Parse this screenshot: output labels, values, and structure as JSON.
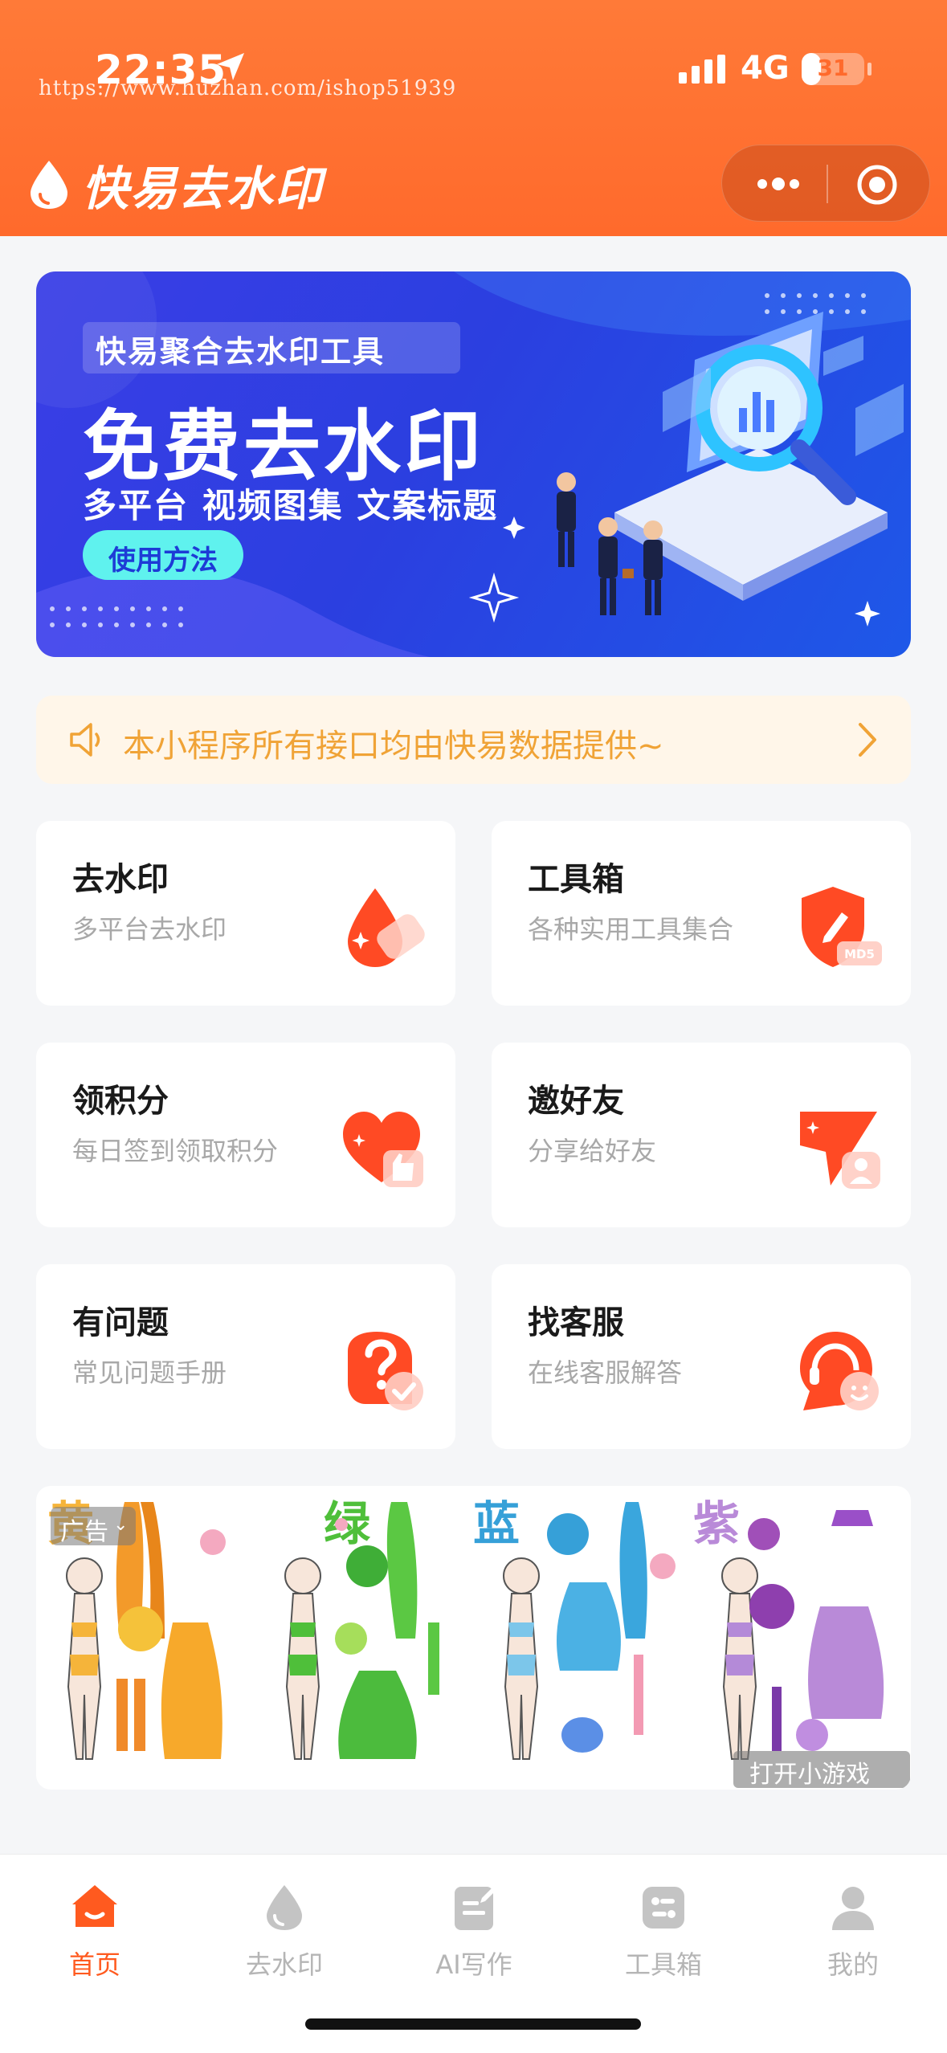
{
  "status_bar": {
    "time": "22:35",
    "network": "4G",
    "battery": "31",
    "battery_level": 0.31
  },
  "watermark": "https://www.huzhan.com/ishop51939",
  "app": {
    "title": "快易去水印"
  },
  "banner": {
    "tagline": "快易聚合去水印工具",
    "title": "免费去水印",
    "subtitle": "多平台 视频图集 文案标题",
    "button": "使用方法"
  },
  "notice": {
    "text": "本小程序所有接口均由快易数据提供~"
  },
  "features": [
    {
      "title": "去水印",
      "subtitle": "多平台去水印",
      "icon": "water-drop-icon"
    },
    {
      "title": "工具箱",
      "subtitle": "各种实用工具集合",
      "icon": "shield-pen-icon",
      "badge": "MD5"
    },
    {
      "title": "领积分",
      "subtitle": "每日签到领取积分",
      "icon": "heart-like-icon"
    },
    {
      "title": "邀好友",
      "subtitle": "分享给好友",
      "icon": "share-plane-icon"
    },
    {
      "title": "有问题",
      "subtitle": "常见问题手册",
      "icon": "question-bubble-icon"
    },
    {
      "title": "找客服",
      "subtitle": "在线客服解答",
      "icon": "headset-icon"
    }
  ],
  "ad": {
    "tag": "广告",
    "colors": [
      {
        "label": "黄",
        "color": "#f5b43a"
      },
      {
        "label": "绿",
        "color": "#4fbf3a"
      },
      {
        "label": "蓝",
        "color": "#36a0d8"
      },
      {
        "label": "紫",
        "color": "#b98ad8"
      }
    ],
    "open_label": "打开小游戏"
  },
  "tabbar": [
    {
      "label": "首页",
      "icon": "home-icon",
      "active": true
    },
    {
      "label": "去水印",
      "icon": "water-drop-icon",
      "active": false
    },
    {
      "label": "AI写作",
      "icon": "edit-doc-icon",
      "active": false
    },
    {
      "label": "工具箱",
      "icon": "toolbox-icon",
      "active": false
    },
    {
      "label": "我的",
      "icon": "user-icon",
      "active": false
    }
  ],
  "colors": {
    "primary": "#ff6a2c",
    "accent": "#ff5a1f",
    "notice_text": "#f0a336",
    "banner_bg": "#2b3fe0"
  }
}
